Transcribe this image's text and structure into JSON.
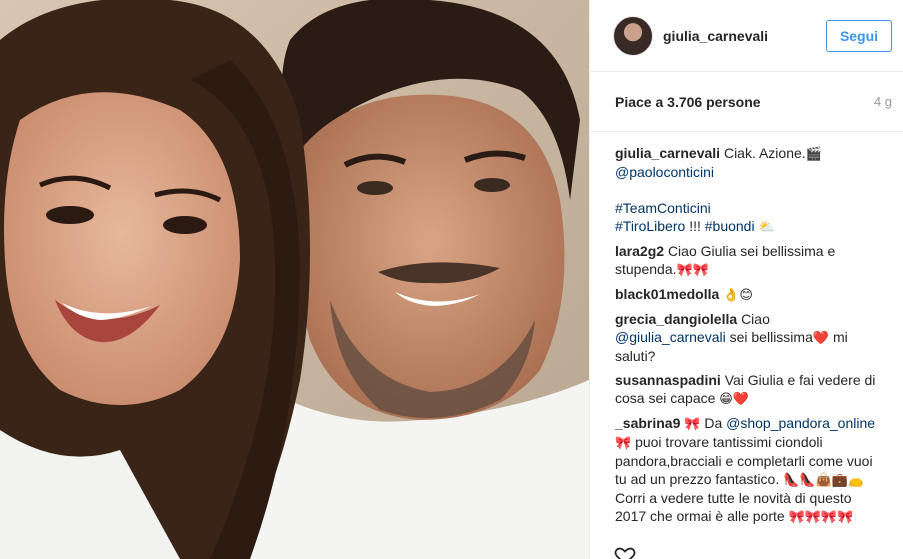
{
  "post": {
    "username": "giulia_carnevali",
    "follow_label": "Segui",
    "likes_text": "Piace a 3.706 persone",
    "time_ago": "4 g"
  },
  "caption": {
    "user": "giulia_carnevali",
    "text": "Ciak. Azione.",
    "emoji": "🎬",
    "mention": "@paoloconticini",
    "tags": [
      "#TeamConticini",
      "#TiroLibero",
      "#buondi"
    ],
    "tags_text": "!!!",
    "tags_emoji": "⛅"
  },
  "comments": [
    {
      "user": "lara2g2",
      "text": "Ciao Giulia sei bellissima e stupenda.",
      "emoji": "🎀🎀"
    },
    {
      "user": "black01medolla",
      "text": "",
      "emoji": "👌😊"
    },
    {
      "user": "grecia_dangiolella",
      "text1": "Ciao",
      "mention": "@giulia_carnevali",
      "text2": "sei bellissima",
      "emoji": "❤️",
      "text3": "mi saluti?"
    },
    {
      "user": "susannaspadini",
      "text": "Vai Giulia e fai vedere di cosa sei capace",
      "emoji": "😁❤️"
    },
    {
      "user": "_sabrina9",
      "emoji1": "🎀",
      "text1": "Da",
      "mention": "@shop_pandora_online",
      "emoji2": "🎀",
      "text2": "puoi trovare tantissimi ciondoli pandora,bracciali e completarli come vuoi tu ad un prezzo fantastico.",
      "emoji3": "👠👠👜💼👝",
      "text3": "Corri a vedere tutte le novità di questo 2017 che ormai è alle porte",
      "emoji4": "🎀🎀🎀🎀"
    }
  ],
  "icons": {
    "heart": "heart-icon"
  }
}
